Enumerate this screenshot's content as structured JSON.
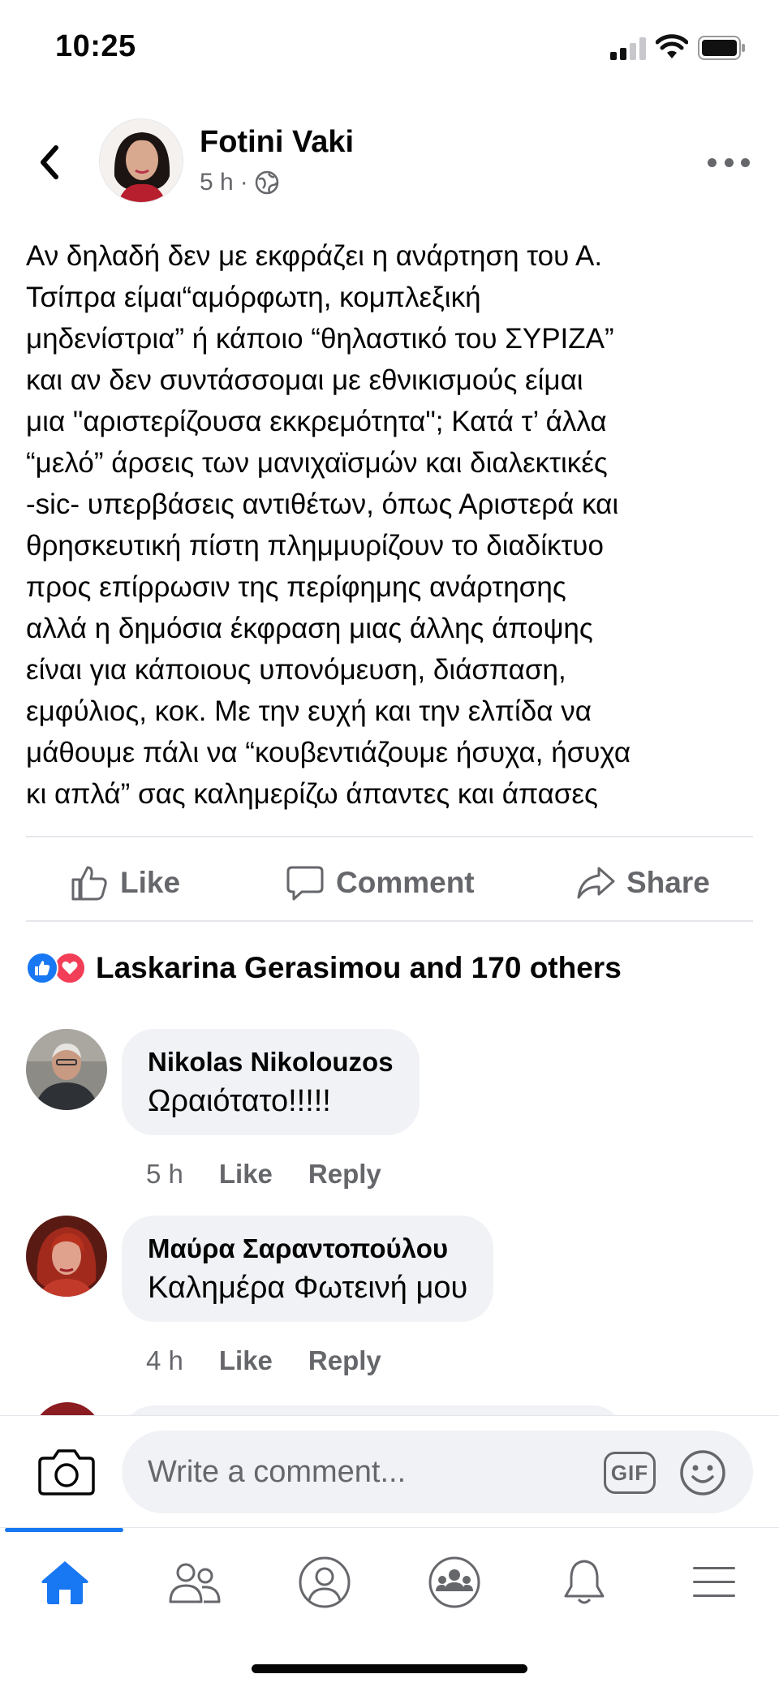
{
  "status_bar": {
    "time": "10:25"
  },
  "post": {
    "author": "Fotini Vaki",
    "time": "5 h",
    "separator": "·",
    "privacy_icon": "globe-icon",
    "text": "Αν δηλαδή δεν με εκφράζει η ανάρτηση του Α.\nΤσίπρα είμαι“αμόρφωτη, κομπλεξική\nμηδενίστρια” ή κάποιο “θηλαστικό του ΣΥΡΙΖΑ”\nκαι αν δεν συντάσσομαι με εθνικισμούς είμαι\nμια \"αριστερίζουσα εκκρεμότητα\"; Κατά τ’ άλλα\n“μελό” άρσεις των μανιχαϊσμών και διαλεκτικές\n-sic- υπερβάσεις αντιθέτων, όπως Αριστερά και\nθρησκευτική πίστη πλημμυρίζουν το διαδίκτυο\nπρος επίρρωσιν της περίφημης ανάρτησης\nαλλά η δημόσια έκφραση μιας άλλης άποψης\nείναι για κάποιους υπονόμευση, διάσπαση,\nεμφύλιος, κοκ. Με την ευχή και την ελπίδα να\nμάθουμε πάλι να “κουβεντιάζουμε ήσυχα, ήσυχα\nκι απλά” σας καλημερίζω άπαντες και άπασες"
  },
  "actions": {
    "like": "Like",
    "comment": "Comment",
    "share": "Share"
  },
  "reactions": {
    "summary": "Laskarina Gerasimou and 170 others"
  },
  "comments": [
    {
      "name": "Nikolas Nikolouzos",
      "text": "Ωραιότατο!!!!!",
      "time": "5 h",
      "like": "Like",
      "reply": "Reply"
    },
    {
      "name": "Μαύρα Σαραντοπούλου",
      "text": "Καλημέρα Φωτεινή μου",
      "time": "4 h",
      "like": "Like",
      "reply": "Reply"
    }
  ],
  "composer": {
    "placeholder": "Write a comment...",
    "gif_label": "GIF"
  },
  "tabbar": {
    "tabs": [
      "home-icon",
      "friends-icon",
      "profile-icon",
      "groups-icon",
      "notifications-icon",
      "menu-icon"
    ],
    "active": "home-icon"
  },
  "colors": {
    "accent": "#1877f2",
    "secondary_text": "#65676b",
    "bubble": "#f0f2f5",
    "love": "#f33e58"
  }
}
